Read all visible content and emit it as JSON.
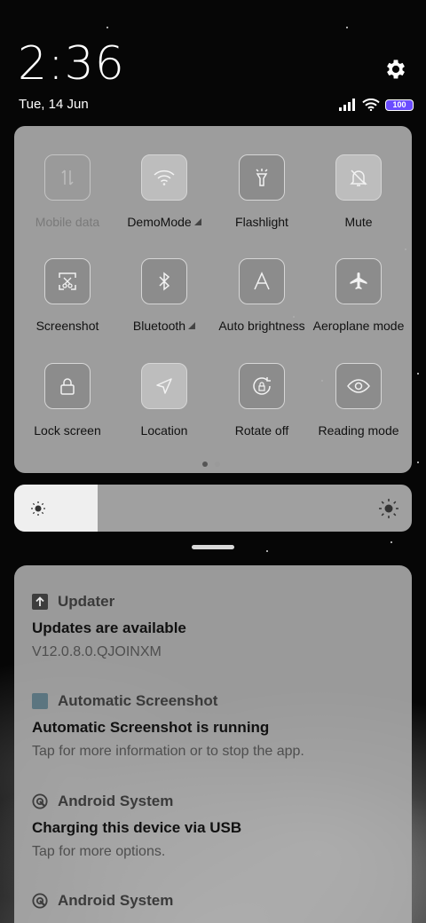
{
  "status": {
    "time": "2:36",
    "date": "Tue, 14 Jun",
    "battery_level": "100",
    "colors": {
      "battery": "#6a4cff"
    }
  },
  "quick_settings": {
    "tiles": [
      {
        "label": "Mobile data",
        "icon": "mobile-data-icon",
        "state": "unavailable"
      },
      {
        "label": "DemoMode",
        "icon": "wifi-icon",
        "state": "on",
        "expandable": true
      },
      {
        "label": "Flashlight",
        "icon": "flashlight-icon",
        "state": "off"
      },
      {
        "label": "Mute",
        "icon": "bell-off-icon",
        "state": "on"
      },
      {
        "label": "Screenshot",
        "icon": "screenshot-icon",
        "state": "off"
      },
      {
        "label": "Bluetooth",
        "icon": "bluetooth-icon",
        "state": "off",
        "expandable": true
      },
      {
        "label": "Auto brightness",
        "icon": "auto-brightness-icon",
        "state": "off"
      },
      {
        "label": "Aeroplane mode",
        "icon": "airplane-icon",
        "state": "off"
      },
      {
        "label": "Lock screen",
        "icon": "lock-icon",
        "state": "off"
      },
      {
        "label": "Location",
        "icon": "location-icon",
        "state": "on"
      },
      {
        "label": "Rotate off",
        "icon": "rotate-lock-icon",
        "state": "off"
      },
      {
        "label": "Reading mode",
        "icon": "eye-icon",
        "state": "off"
      }
    ],
    "current_page": 1,
    "page_count": 2
  },
  "brightness": {
    "level": 0.21
  },
  "notifications": [
    {
      "app": "Updater",
      "icon": "upload-arrow-icon",
      "title": "Updates are available",
      "text": "V12.0.8.0.QJOINXM"
    },
    {
      "app": "Automatic Screenshot",
      "icon": "app-square-icon",
      "title": "Automatic Screenshot is running",
      "text": "Tap for more information or to stop the app."
    },
    {
      "app": "Android System",
      "icon": "android-system-icon",
      "title": "Charging this device via USB",
      "text": "Tap for more options."
    },
    {
      "app": "Android System",
      "icon": "android-system-icon",
      "title": "",
      "text": ""
    }
  ]
}
